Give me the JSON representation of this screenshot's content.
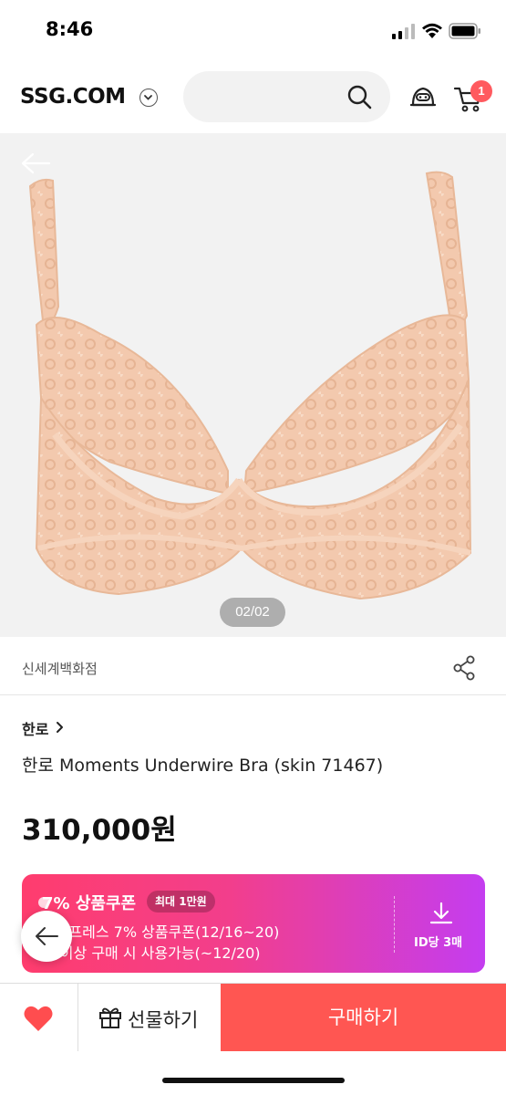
{
  "status_bar": {
    "time": "8:46"
  },
  "header": {
    "logo": "SSG.COM",
    "cart_count": "1"
  },
  "product_image": {
    "page_indicator": "02/02"
  },
  "store": {
    "name": "신세계백화점"
  },
  "product": {
    "brand": "한로",
    "title": "한로 Moments Underwire Bra (skin 71467)",
    "price": "310,000원"
  },
  "coupon": {
    "title": "7% 상품쿠폰",
    "max_badge": "최대 1만원",
    "line1": "익스프레스 7% 상품쿠폰(12/16~20)",
    "line2": "원 이상 구매 시 사용가능(~12/20)",
    "limit": "ID당 3매"
  },
  "bottom_bar": {
    "gift_label": "선물하기",
    "buy_label": "구매하기"
  },
  "colors": {
    "accent": "#ff5652",
    "heart": "#ff4d4f",
    "coupon_start": "#ff3d6e",
    "coupon_end": "#c43df0",
    "product_skin": "#f3c9ae"
  },
  "icons": [
    "signal-icon",
    "wifi-icon",
    "battery-icon",
    "chevron-down-icon",
    "search-icon",
    "bot-icon",
    "cart-icon",
    "back-arrow-icon",
    "share-icon",
    "chevron-right-icon",
    "download-icon",
    "heart-icon",
    "gift-icon"
  ]
}
